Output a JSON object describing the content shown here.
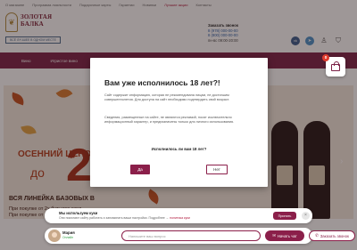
{
  "top_nav": {
    "items": [
      "О магазине",
      "Программа лояльности",
      "Подарочные карты",
      "Гарантии",
      "Новинки",
      "Лучшие акции",
      "Контакты"
    ]
  },
  "logo": {
    "line1": "ЗОЛОТАЯ",
    "line2": "БАЛКА",
    "sub": "ВСЁ ЛУЧШЕЕ В ОДНОМ МЕСТЕ"
  },
  "contacts": {
    "title": "Заказать звонок",
    "phone1": "8 (978) 000-00-00",
    "phone2": "8 (800) 000-00-00",
    "hours": "пн-вс 09:00-20:00"
  },
  "header_icons": [
    "vk-icon",
    "telegram-icon",
    "user-icon",
    "cart-icon"
  ],
  "menu": {
    "items": [
      "Вино",
      "Игристое вино"
    ]
  },
  "hero": {
    "title": "ОСЕННИЙ ЦЕНОПАД",
    "prefix": "до",
    "percent": "20%",
    "subtitle": "ВСЯ ЛИНЕЙКА БАЗОВЫХ В",
    "line1": "При покупке от 2х бутылок скид",
    "line2": "При покупке от 3-х бутылок скидка 10%"
  },
  "cart_badge": "0",
  "modal": {
    "title": "Вам уже исполнилось 18 лет?!",
    "paragraph1": "Сайт содержит информацию, которая не рекомендована лицам, не достигшим совершеннолетия. Для доступа на сайт необходимо подтвердить свой возраст.",
    "paragraph2": "Сведения, размещенные на сайте, не являются рекламой, носят исключительно информационный характер, и предназначены только для личного использования.",
    "question": "Исполнилось ли вам 18 лет?",
    "yes_label": "Да",
    "no_label": "Нет"
  },
  "cookie": {
    "title": "Мы используем куки",
    "text": "Они помогают сайту работать и запоминать ваши настройки. Подробнее →",
    "link": "политика куки",
    "accept_label": "Принять",
    "close_icon": "close-icon"
  },
  "chat": {
    "agent_name": "Мария",
    "agent_status": "Онлайн",
    "input_placeholder": "Напишите ваш вопрос",
    "chat_button": "Начать чат",
    "call_button": "Заказать звонок"
  },
  "colors": {
    "brand": "#8b1f4a",
    "menu_bar": "#7b2045",
    "badge": "#e03c2e"
  }
}
